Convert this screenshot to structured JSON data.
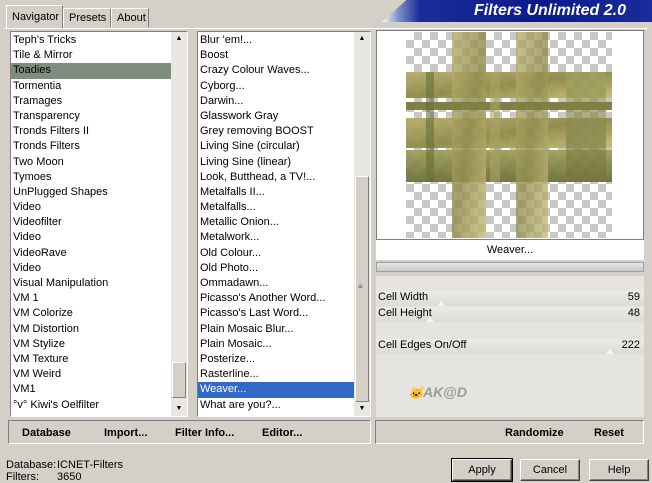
{
  "tabs": [
    "Navigator",
    "Presets",
    "About"
  ],
  "banner_title": "Filters Unlimited 2.0",
  "category_list": [
    "Teph's Tricks",
    "Tile & Mirror",
    "Toadies",
    "Tormentia",
    "Tramages",
    "Transparency",
    "Tronds Filters II",
    "Tronds Filters",
    "Two Moon",
    "Tymoes",
    "UnPlugged Shapes",
    "Video",
    "Videofilter",
    "Video",
    "VideoRave",
    "Video",
    "Visual Manipulation",
    "VM 1",
    "VM Colorize",
    "VM Distortion",
    "VM Stylize",
    "VM Texture",
    "VM Weird",
    "VM1",
    "°v° Kiwi's Oelfilter"
  ],
  "filter_list": [
    "Blur 'em!...",
    "Boost",
    "Crazy Colour Waves...",
    "Cyborg...",
    "Darwin...",
    "Glasswork Gray",
    "Grey removing BOOST",
    "Living Sine (circular)",
    "Living Sine (linear)",
    "Look, Butthead, a TV!...",
    "Metalfalls II...",
    "Metalfalls...",
    "Metallic Onion...",
    "Metalwork...",
    "Old Colour...",
    "Old Photo...",
    "Ommadawn...",
    "Picasso's Another Word...",
    "Picasso's Last Word...",
    "Plain Mosaic Blur...",
    "Plain Mosaic...",
    "Posterize...",
    "Rasterline...",
    "Weaver...",
    "What are you?..."
  ],
  "preview_filter_name": "Weaver...",
  "params": [
    {
      "label": "Cell Width",
      "value": "59",
      "level": 0.23
    },
    {
      "label": "Cell Height",
      "value": "48",
      "level": 0.19
    },
    {
      "label": "Cell Edges On/Off",
      "value": "222",
      "level": 0.87
    }
  ],
  "bottom_buttons": {
    "database": "Database",
    "import": "Import...",
    "filter_info": "Filter Info...",
    "editor": "Editor...",
    "randomize": "Randomize",
    "reset": "Reset"
  },
  "status": {
    "database_label": "Database:",
    "database_value": "ICNET-Filters",
    "filters_label": "Filters:",
    "filters_value": "3650"
  },
  "dialog_buttons": {
    "apply": "Apply",
    "cancel": "Cancel",
    "help": "Help"
  },
  "watermark": "AK@D",
  "colors": {
    "selection_blue": "#3169c6",
    "selection_gray": "#7f8d7f",
    "banner": "#0a1a8a"
  }
}
